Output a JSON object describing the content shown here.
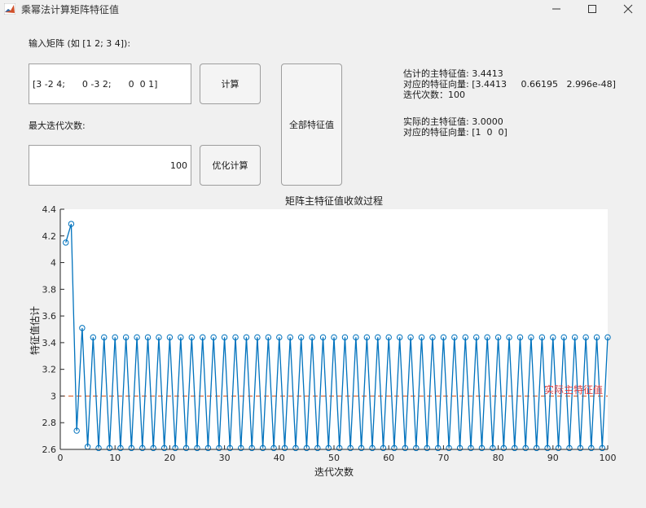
{
  "window": {
    "title": "乘幂法计算矩阵特征值",
    "minimize_icon": "minimize-icon",
    "maximize_icon": "maximize-icon",
    "close_icon": "close-icon",
    "app_icon": "matlab-icon"
  },
  "form": {
    "matrix_label": "输入矩阵 (如 [1 2; 3 4]):",
    "matrix_value": "[3 -2 4;      0 -3 2;      0  0 1]",
    "iter_label": "最大迭代次数:",
    "iter_value": "100",
    "compute_button": "计算",
    "optimize_button": "优化计算",
    "all_eig_button": "全部特征值"
  },
  "results": {
    "est_eig": "估计的主特征值: 3.4413",
    "est_vec": "对应的特征向量: [3.4413     0.66195   2.996e-48]",
    "iterations": "迭代次数：100",
    "true_eig": "实际的主特征值: 3.0000",
    "true_vec": "对应的特征向量: [1  0  0]"
  },
  "colors": {
    "series": "#0072bd",
    "reference": "#d95319",
    "reference_text": "#e04040"
  },
  "chart_data": {
    "type": "line",
    "title": "矩阵主特征值收敛过程",
    "xlabel": "迭代次数",
    "ylabel": "特征值估计",
    "xlim": [
      0,
      100
    ],
    "ylim": [
      2.6,
      4.4
    ],
    "xticks": [
      0,
      10,
      20,
      30,
      40,
      50,
      60,
      70,
      80,
      90,
      100
    ],
    "yticks": [
      2.6,
      2.8,
      3,
      3.2,
      3.4,
      3.6,
      3.8,
      4,
      4.2,
      4.4
    ],
    "grid": false,
    "series": [
      {
        "marker": "circle",
        "x": [
          1,
          2,
          3,
          4,
          5,
          6,
          7,
          8,
          9,
          10,
          11,
          12,
          13,
          14,
          15,
          16,
          17,
          18,
          19,
          20,
          21,
          22,
          23,
          24,
          25,
          26,
          27,
          28,
          29,
          30,
          31,
          32,
          33,
          34,
          35,
          36,
          37,
          38,
          39,
          40,
          41,
          42,
          43,
          44,
          45,
          46,
          47,
          48,
          49,
          50,
          51,
          52,
          53,
          54,
          55,
          56,
          57,
          58,
          59,
          60,
          61,
          62,
          63,
          64,
          65,
          66,
          67,
          68,
          69,
          70,
          71,
          72,
          73,
          74,
          75,
          76,
          77,
          78,
          79,
          80,
          81,
          82,
          83,
          84,
          85,
          86,
          87,
          88,
          89,
          90,
          91,
          92,
          93,
          94,
          95,
          96,
          97,
          98,
          99,
          100
        ],
        "y": [
          4.15,
          4.29,
          2.74,
          3.51,
          2.62,
          3.44,
          2.61,
          3.44,
          2.61,
          3.44,
          2.61,
          3.44,
          2.61,
          3.44,
          2.61,
          3.44,
          2.61,
          3.44,
          2.61,
          3.44,
          2.61,
          3.44,
          2.61,
          3.44,
          2.61,
          3.44,
          2.61,
          3.44,
          2.61,
          3.44,
          2.61,
          3.44,
          2.61,
          3.44,
          2.61,
          3.44,
          2.61,
          3.44,
          2.61,
          3.44,
          2.61,
          3.44,
          2.61,
          3.44,
          2.61,
          3.44,
          2.61,
          3.44,
          2.61,
          3.44,
          2.61,
          3.44,
          2.61,
          3.44,
          2.61,
          3.44,
          2.61,
          3.44,
          2.61,
          3.44,
          2.61,
          3.44,
          2.61,
          3.44,
          2.61,
          3.44,
          2.61,
          3.44,
          2.61,
          3.44,
          2.61,
          3.44,
          2.61,
          3.44,
          2.61,
          3.44,
          2.61,
          3.44,
          2.61,
          3.44,
          2.61,
          3.44,
          2.61,
          3.44,
          2.61,
          3.44,
          2.61,
          3.44,
          2.61,
          3.44,
          2.61,
          3.44,
          2.61,
          3.44,
          2.61,
          3.44,
          2.61,
          3.44,
          2.61,
          3.44
        ]
      }
    ],
    "reference_line": {
      "y": 3.0,
      "label": "实际主特征值"
    }
  }
}
